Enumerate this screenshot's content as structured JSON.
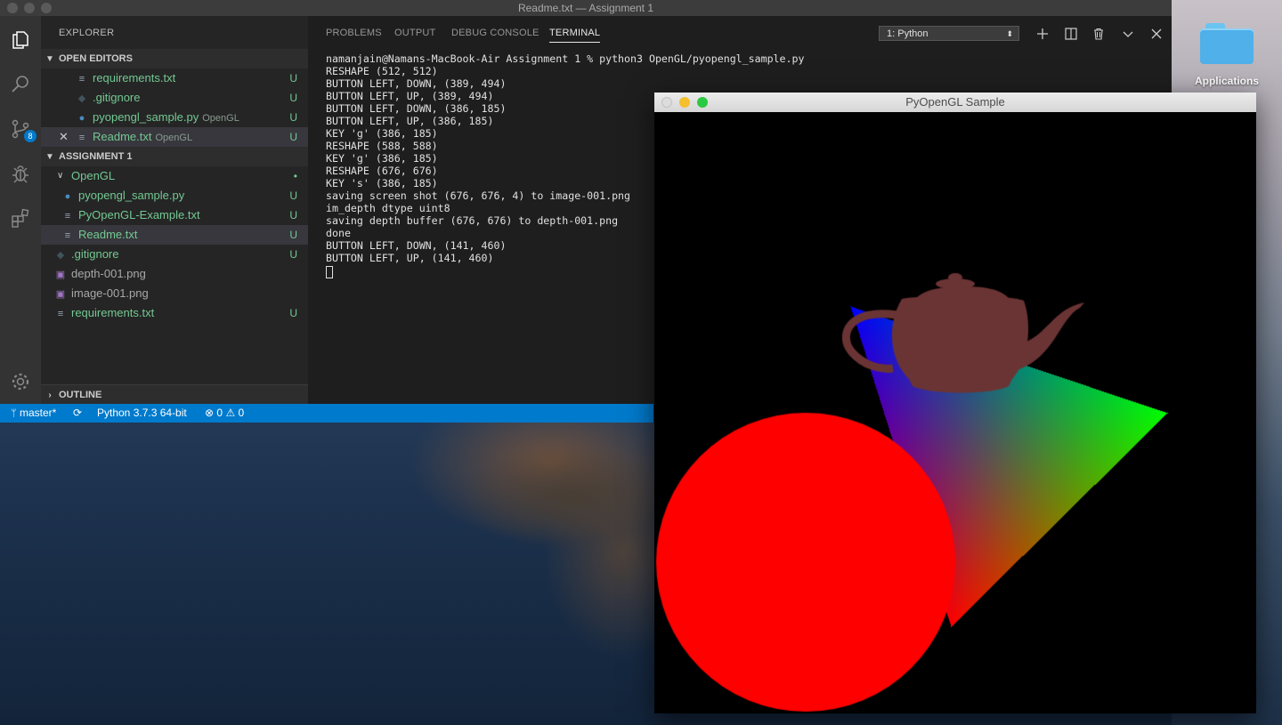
{
  "desktop": {
    "applications_label": "Applications"
  },
  "vscode": {
    "window_title": "Readme.txt — Assignment 1",
    "activity_bar": {
      "scm_badge": "8"
    },
    "sidebar": {
      "header": "EXPLORER",
      "open_editors": {
        "title": "OPEN EDITORS",
        "items": [
          {
            "name": "requirements.txt",
            "icon": "text-file-icon",
            "status": "U",
            "folder": ""
          },
          {
            "name": ".gitignore",
            "icon": "git-file-icon",
            "status": "U",
            "folder": ""
          },
          {
            "name": "pyopengl_sample.py",
            "icon": "python-file-icon",
            "status": "U",
            "folder": "OpenGL"
          },
          {
            "name": "Readme.txt",
            "icon": "text-file-icon",
            "status": "U",
            "folder": "OpenGL"
          }
        ]
      },
      "workspace": {
        "title": "ASSIGNMENT 1",
        "items": [
          {
            "name": "OpenGL",
            "type": "folder",
            "status": "•"
          },
          {
            "name": "pyopengl_sample.py",
            "icon": "python-file-icon",
            "status": "U"
          },
          {
            "name": "PyOpenGL-Example.txt",
            "icon": "text-file-icon",
            "status": "U"
          },
          {
            "name": "Readme.txt",
            "icon": "text-file-icon",
            "status": "U"
          },
          {
            "name": ".gitignore",
            "icon": "git-file-icon",
            "status": "U"
          },
          {
            "name": "depth-001.png",
            "icon": "image-file-icon",
            "status": ""
          },
          {
            "name": "image-001.png",
            "icon": "image-file-icon",
            "status": ""
          },
          {
            "name": "requirements.txt",
            "icon": "text-file-icon",
            "status": "U"
          }
        ]
      },
      "outline_title": "OUTLINE"
    },
    "panel": {
      "tabs": [
        "PROBLEMS",
        "OUTPUT",
        "DEBUG CONSOLE",
        "TERMINAL"
      ],
      "active_tab": "TERMINAL",
      "terminal_select": "1: Python",
      "terminal_lines": [
        "namanjain@Namans-MacBook-Air Assignment 1 % python3 OpenGL/pyopengl_sample.py",
        "RESHAPE (512, 512)",
        "BUTTON LEFT, DOWN, (389, 494)",
        "BUTTON LEFT, UP, (389, 494)",
        "BUTTON LEFT, DOWN, (386, 185)",
        "BUTTON LEFT, UP, (386, 185)",
        "KEY 'g' (386, 185)",
        "RESHAPE (588, 588)",
        "KEY 'g' (386, 185)",
        "RESHAPE (676, 676)",
        "KEY 's' (386, 185)",
        "saving screen shot (676, 676, 4) to image-001.png",
        "im_depth dtype uint8",
        "saving depth buffer (676, 676) to depth-001.png",
        "done",
        "BUTTON LEFT, DOWN, (141, 460)",
        "BUTTON LEFT, UP, (141, 460)"
      ]
    },
    "statusbar": {
      "branch": "master*",
      "python": "Python 3.7.3 64-bit",
      "errors": "0",
      "warnings": "0"
    }
  },
  "gl_window": {
    "title": "PyOpenGL Sample",
    "colors": {
      "background": "#000000",
      "sphere": "#ff0000",
      "teapot": "#6b3434",
      "triangle_vertices": [
        "#0000ff",
        "#00ff00",
        "#ff0000"
      ]
    }
  }
}
